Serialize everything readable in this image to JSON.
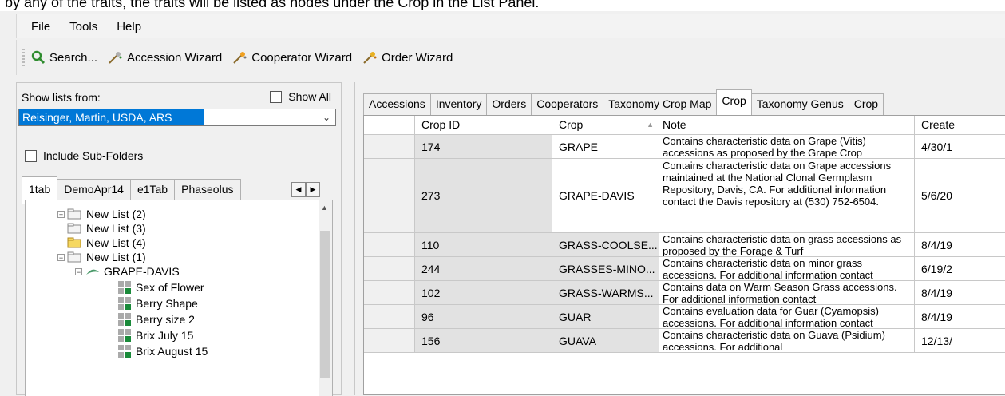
{
  "caption": "by any of the traits, the traits will be listed as nodes under the Crop in the List Panel.",
  "menu": [
    "File",
    "Tools",
    "Help"
  ],
  "toolbar": {
    "search": "Search...",
    "accession_wizard": "Accession Wizard",
    "cooperator_wizard": "Cooperator Wizard",
    "order_wizard": "Order Wizard"
  },
  "left_panel": {
    "show_lists_label": "Show lists from:",
    "show_all_label": "Show All",
    "owner_value": "Reisinger, Martin, USDA, ARS",
    "include_subfolders_label": "Include Sub-Folders",
    "tabs": [
      "1tab",
      "DemoApr14",
      "e1Tab",
      "Phaseolus"
    ],
    "tree": {
      "lists": [
        "New List (2)",
        "New List (3)",
        "New List (4)",
        "New List (1)"
      ],
      "crop": "GRAPE-DAVIS",
      "traits": [
        "Sex of Flower",
        "Berry Shape",
        "Berry size 2",
        "Brix July 15",
        "Brix August 15"
      ]
    }
  },
  "right_panel": {
    "tabs": [
      "Accessions",
      "Inventory",
      "Orders",
      "Cooperators",
      "Taxonomy Crop Map",
      "Crop",
      "Taxonomy Genus",
      "Crop"
    ],
    "columns": {
      "crop_id": "Crop ID",
      "crop": "Crop",
      "sort_indicator": "▲",
      "note": "Note",
      "created": "Create"
    },
    "rows": [
      {
        "id": "174",
        "crop": "GRAPE",
        "note": "Contains characteristic data on Grape (Vitis) accessions as proposed by the Grape Crop",
        "created": "4/30/1"
      },
      {
        "id": "273",
        "crop": "GRAPE-DAVIS",
        "note": "Contains characteristic data on Grape accessions maintained at the National Clonal Germplasm Repository, Davis, CA.  For additional information contact the Davis repository at (530) 752-6504.",
        "created": "5/6/20"
      },
      {
        "id": "110",
        "crop": "GRASS-COOLSE...",
        "note": "Contains characteristic data on grass accessions as proposed by the Forage & Turf",
        "created": "8/4/19"
      },
      {
        "id": "244",
        "crop": "GRASSES-MINO...",
        "note": "Contains characteristic data on minor grass accessions. For additional information contact",
        "created": "6/19/2"
      },
      {
        "id": "102",
        "crop": "GRASS-WARMS...",
        "note": "Contains data on Warm Season Grass accessions. For additional information contact",
        "created": "8/4/19"
      },
      {
        "id": "96",
        "crop": "GUAR",
        "note": "Contains evaluation data for Guar (Cyamopsis) accessions. For additional information contact",
        "created": "8/4/19"
      },
      {
        "id": "156",
        "crop": "GUAVA",
        "note": "Contains characteristic data on Guava (Psidium) accessions. For additional",
        "created": "12/13/"
      }
    ]
  },
  "colors": {
    "selection": "#0078d7",
    "panel": "#f0f0f0",
    "grid_shade": "#e2e2e2"
  }
}
